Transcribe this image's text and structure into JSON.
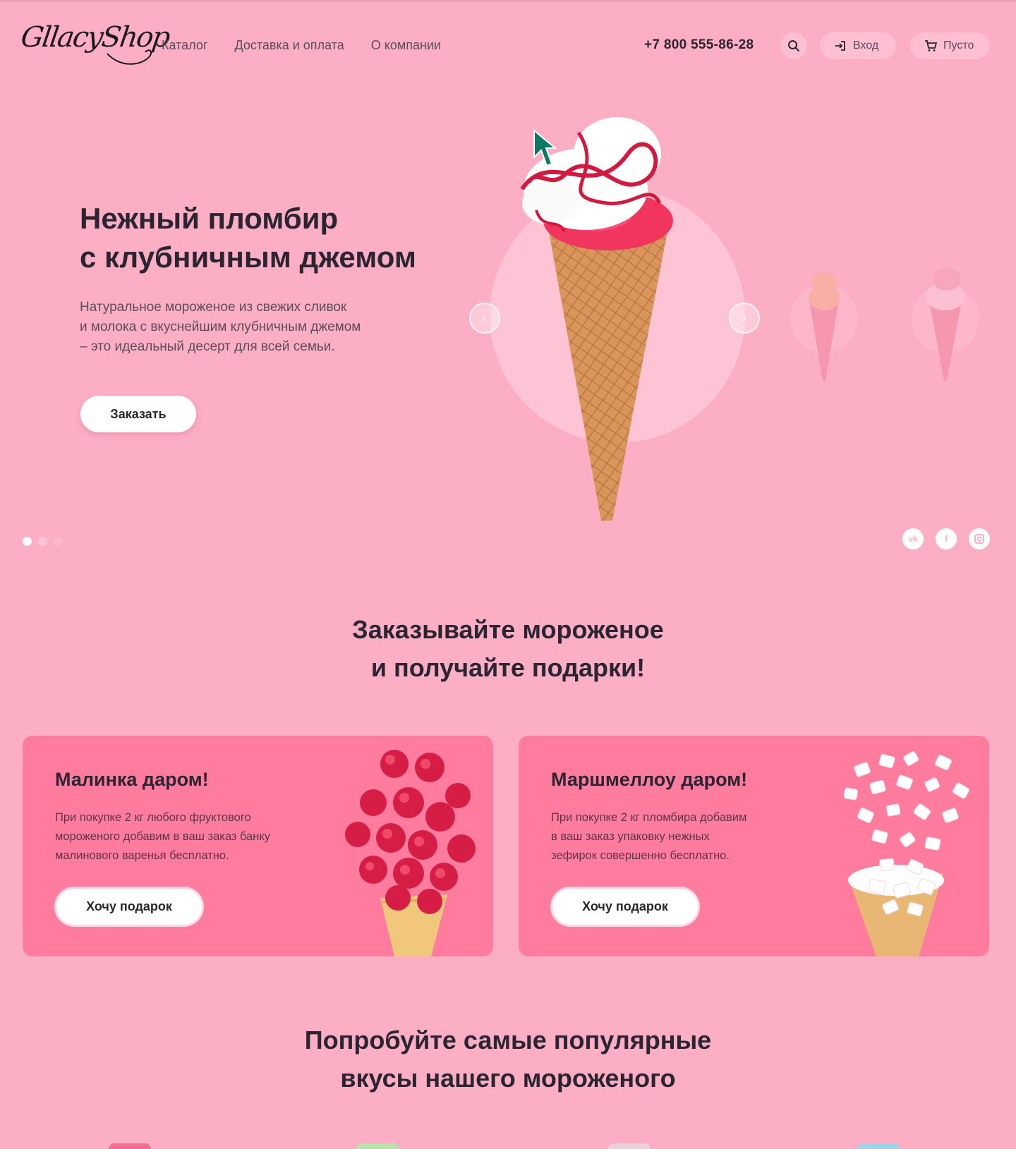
{
  "header": {
    "logo_text": "GllacyShop",
    "nav": [
      "Каталог",
      "Доставка и оплата",
      "О компании"
    ],
    "phone": "+7 800 555-86-28",
    "login_label": "Вход",
    "cart_label": "Пусто"
  },
  "hero": {
    "title_line1": "Нежный пломбир",
    "title_line2": "с клубничным джемом",
    "desc_line1": "Натуральное мороженое из свежих сливок",
    "desc_line2": "и молока с вкуснейшим клубничным джемом",
    "desc_line3": "– это идеальный десерт для всей семьи.",
    "order_label": "Заказать",
    "slides_total": 3,
    "slide_active": 1,
    "socials": [
      "vk",
      "f",
      "ig"
    ]
  },
  "gifts": {
    "title_line1": "Заказывайте мороженое",
    "title_line2": "и получайте подарки!",
    "cards": [
      {
        "title": "Малинка даром!",
        "text_line1": "При покупке 2 кг любого фруктового",
        "text_line2": "мороженого добавим в ваш заказ банку",
        "text_line3": "малинового варенья бесплатно.",
        "button": "Хочу подарок"
      },
      {
        "title": "Маршмеллоу даром!",
        "text_line1": "При покупке 2 кг пломбира добавим",
        "text_line2": "в ваш заказ упаковку нежных",
        "text_line3": "зефирок совершенно бесплатно.",
        "button": "Хочу подарок"
      }
    ]
  },
  "popular": {
    "title_line1": "Попробуйте самые популярные",
    "title_line2": "вкусы нашего мороженого"
  },
  "colors": {
    "background": "#fcaec5",
    "accent": "#ff7c9f",
    "text_dark": "#2b2531"
  }
}
